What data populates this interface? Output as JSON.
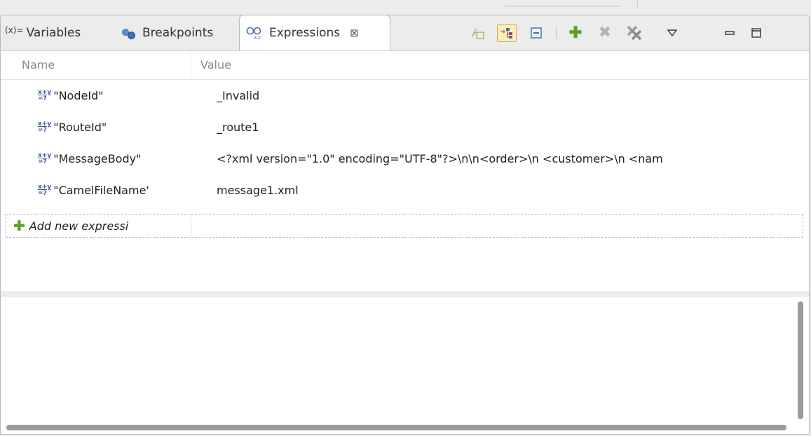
{
  "tabs": {
    "variables": {
      "prefix": "(x)=",
      "label": "Variables"
    },
    "breakpoints": {
      "label": "Breakpoints"
    },
    "expressions": {
      "label": "Expressions",
      "close": "⊠"
    }
  },
  "toolbar": {
    "show_type_names": {
      "icon": "type-names-icon"
    },
    "show_logical_structure": {
      "icon": "logical-structure-icon",
      "active": true
    },
    "collapse_all": {
      "icon": "collapse-all-icon"
    },
    "add_watch": {
      "icon": "plus-icon"
    },
    "remove_selected": {
      "icon": "remove-icon",
      "enabled": false
    },
    "remove_all": {
      "icon": "remove-all-icon"
    },
    "view_menu": {
      "icon": "triangle-down-icon"
    },
    "minimize": {
      "icon": "minimize-icon"
    },
    "maximize": {
      "icon": "maximize-icon"
    }
  },
  "columns": {
    "name": "Name",
    "value": "Value"
  },
  "expressions": [
    {
      "name": "\"NodeId\"",
      "value": "_Invalid"
    },
    {
      "name": "\"RouteId\"",
      "value": "_route1"
    },
    {
      "name": "\"MessageBody\"",
      "value": "<?xml version=\"1.0\" encoding=\"UTF-8\"?>\\n\\n<order>\\n  <customer>\\n    <nam"
    },
    {
      "name": "\"CamelFileName'",
      "value": "message1.xml"
    }
  ],
  "add_expression": {
    "label": "Add new expressi"
  },
  "icons": {
    "expression": "x+y/=?",
    "plus_color": "#5aa02c",
    "accent": "#3e5a9a"
  }
}
